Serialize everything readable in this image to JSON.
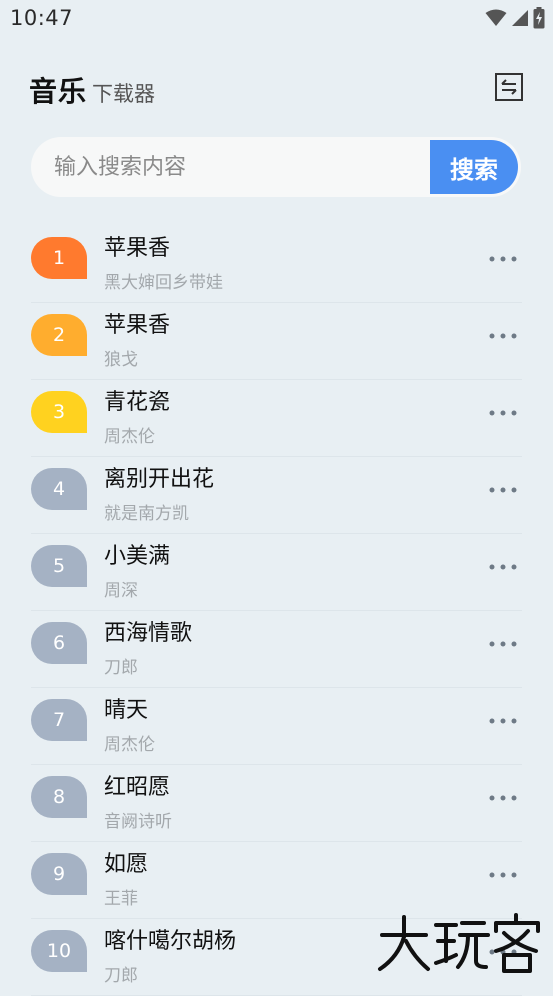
{
  "status_bar": {
    "time": "10:47",
    "icons": [
      "wifi-icon",
      "signal-icon",
      "battery-charging-icon"
    ]
  },
  "header": {
    "title": "音乐",
    "subtitle": "下载器",
    "action_icon": "swap-icon"
  },
  "search": {
    "placeholder": "输入搜索内容",
    "value": "",
    "button_label": "搜索"
  },
  "colors": {
    "background": "#e8eff3",
    "accent": "#4a8ff2",
    "rank_1": "#ff7a2e",
    "rank_2": "#ffad2e",
    "rank_3": "#ffd21f",
    "rank_default": "#a5b2c4"
  },
  "songs": [
    {
      "rank": "1",
      "title": "苹果香",
      "artist": "黑大婶回乡带娃"
    },
    {
      "rank": "2",
      "title": "苹果香",
      "artist": "狼戈"
    },
    {
      "rank": "3",
      "title": "青花瓷",
      "artist": "周杰伦"
    },
    {
      "rank": "4",
      "title": "离别开出花",
      "artist": "就是南方凯"
    },
    {
      "rank": "5",
      "title": "小美满",
      "artist": "周深"
    },
    {
      "rank": "6",
      "title": "西海情歌",
      "artist": "刀郎"
    },
    {
      "rank": "7",
      "title": "晴天",
      "artist": "周杰伦"
    },
    {
      "rank": "8",
      "title": "红昭愿",
      "artist": "音阙诗听"
    },
    {
      "rank": "9",
      "title": "如愿",
      "artist": "王菲"
    },
    {
      "rank": "10",
      "title": "喀什噶尔胡杨",
      "artist": "刀郎"
    }
  ],
  "watermark": {
    "text": "大玩客"
  }
}
